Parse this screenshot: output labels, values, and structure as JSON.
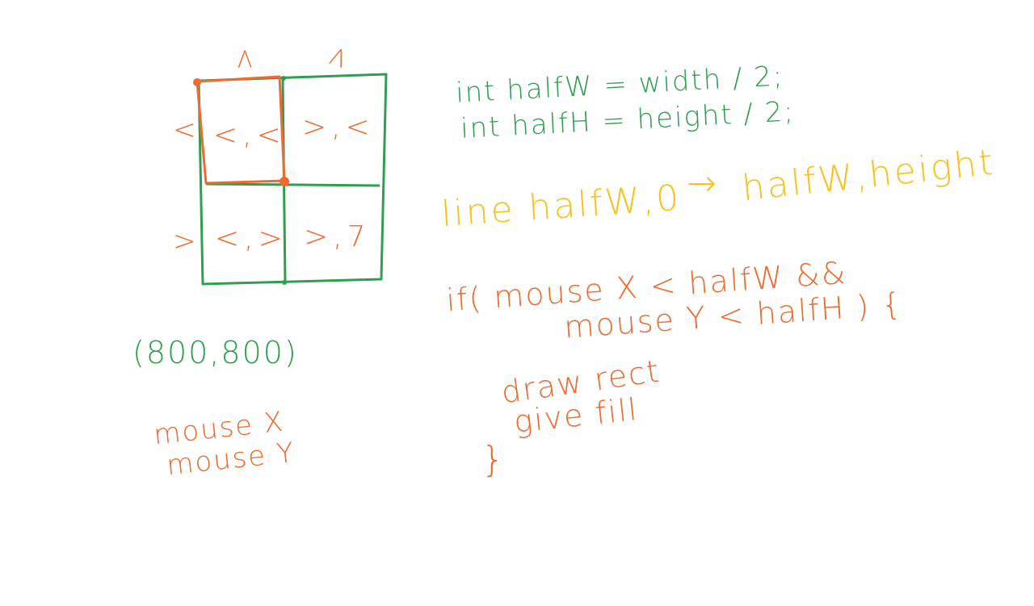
{
  "colors": {
    "green": "#2e9e4f",
    "orange": "#ee6a2e",
    "yellow": "#f7c21e",
    "background": "#ffffff"
  },
  "grid": {
    "top_labels": [
      "<",
      ">"
    ],
    "side_labels": [
      "<",
      ">"
    ],
    "cells": [
      "<,<",
      ">,<",
      "<,>",
      ">,7"
    ]
  },
  "canvas_size": "(800,800)",
  "mouse_vars": [
    "mouse X",
    "mouse Y"
  ],
  "code": {
    "line1": "int halfW = width / 2;",
    "line2": "int halfH = height / 2;",
    "line_call": "line halfW,0",
    "arrow": "→",
    "line_end": "halfW,height",
    "if_line1": "if( mouse X < halfW &&",
    "if_line2": "mouse Y < halfH ) {",
    "body1": "draw rect",
    "body2": "give fill",
    "close_brace": "}"
  }
}
